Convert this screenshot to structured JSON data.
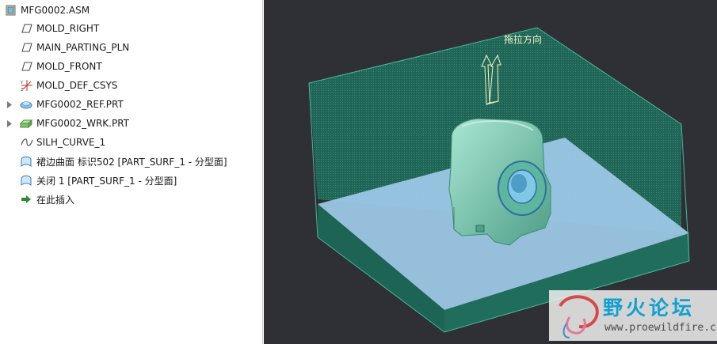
{
  "model_tree": {
    "items": [
      {
        "label": "MFG0002.ASM",
        "icon": "assembly-icon",
        "expandable": false
      },
      {
        "label": "MOLD_RIGHT",
        "icon": "datum-plane-icon",
        "expandable": false
      },
      {
        "label": "MAIN_PARTING_PLN",
        "icon": "datum-plane-icon",
        "expandable": false
      },
      {
        "label": "MOLD_FRONT",
        "icon": "datum-plane-icon",
        "expandable": false
      },
      {
        "label": "MOLD_DEF_CSYS",
        "icon": "coordinate-system-icon",
        "expandable": false
      },
      {
        "label": "MFG0002_REF.PRT",
        "icon": "reference-part-icon",
        "expandable": true
      },
      {
        "label": "MFG0002_WRK.PRT",
        "icon": "workpiece-icon",
        "expandable": true
      },
      {
        "label": "SILH_CURVE_1",
        "icon": "curve-icon",
        "expandable": false
      },
      {
        "label": "裙边曲面 标识502 [PART_SURF_1 - 分型面]",
        "icon": "surface-icon",
        "expandable": false
      },
      {
        "label": "关闭 1 [PART_SURF_1 - 分型面]",
        "icon": "surface-icon",
        "expandable": false
      },
      {
        "label": "在此插入",
        "icon": "insert-here-arrow-icon",
        "expandable": false
      }
    ]
  },
  "viewport": {
    "pull_direction_label": "拖拉方向",
    "background_color": "#2e3036",
    "workpiece_color": "#1f7a62",
    "parting_surface_color": "#9cc7e6",
    "part_color": "#6fbfa8"
  },
  "watermark": {
    "title": "野火论坛",
    "url": "www.proewildfire.cn"
  }
}
